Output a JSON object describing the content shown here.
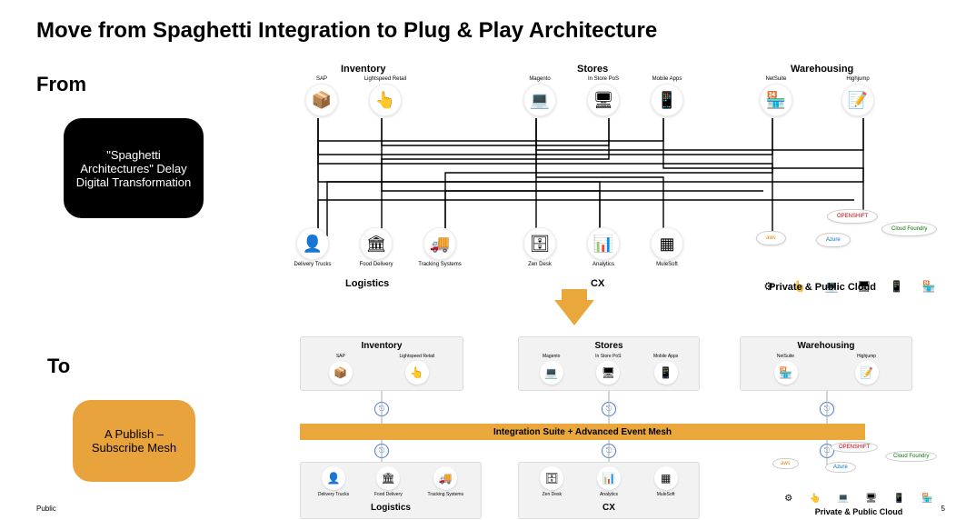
{
  "title": "Move from Spaghetti Integration to Plug & Play Architecture",
  "from_label": "From",
  "to_label": "To",
  "black_box": "\"Spaghetti Architectures\" Delay Digital Transformation",
  "orange_box": "A Publish – Subscribe Mesh",
  "footer": "Public",
  "page": "5",
  "down_arrow": "▼",
  "top": {
    "groups_upper": {
      "inventory": {
        "label": "Inventory",
        "systems": [
          {
            "name": "SAP",
            "glyph": "📦"
          },
          {
            "name": "Lightspeed Retail",
            "glyph": "👆"
          }
        ]
      },
      "stores": {
        "label": "Stores",
        "systems": [
          {
            "name": "Magento",
            "glyph": "💻"
          },
          {
            "name": "In Store PoS",
            "glyph": "🖥"
          },
          {
            "name": "Mobile Apps",
            "glyph": "📱"
          }
        ]
      },
      "warehousing": {
        "label": "Warehousing",
        "systems": [
          {
            "name": "NetSuite",
            "glyph": "🏪"
          },
          {
            "name": "Highjump",
            "glyph": "📝"
          }
        ]
      }
    },
    "groups_lower": {
      "logistics": {
        "label": "Logistics",
        "systems": [
          {
            "name": "Delivery Trucks",
            "glyph": "👤"
          },
          {
            "name": "Food Delivery",
            "glyph": "🏛"
          },
          {
            "name": "Tracking Systems",
            "glyph": "🚚"
          }
        ]
      },
      "cx": {
        "label": "CX",
        "systems": [
          {
            "name": "Zen Desk",
            "glyph": "🗄"
          },
          {
            "name": "Analytics",
            "glyph": "📊"
          },
          {
            "name": "MuleSoft",
            "glyph": "▦"
          }
        ]
      },
      "cloud": {
        "label": "Private & Public Cloud",
        "platforms": [
          "OPENSHIFT",
          "aws",
          "Azure",
          "Cloud Foundry"
        ],
        "mini_icons": [
          "⚙",
          "👆",
          "💻",
          "🖥",
          "📱",
          "🏪"
        ]
      }
    }
  },
  "bus_label": "Integration Suite + Advanced Event Mesh",
  "bottom": {
    "inventory": {
      "label": "Inventory",
      "systems": [
        {
          "name": "SAP",
          "glyph": "📦"
        },
        {
          "name": "Lightspeed Retail",
          "glyph": "👆"
        }
      ]
    },
    "stores": {
      "label": "Stores",
      "systems": [
        {
          "name": "Magento",
          "glyph": "💻"
        },
        {
          "name": "In Store PoS",
          "glyph": "🖥"
        },
        {
          "name": "Mobile Apps",
          "glyph": "📱"
        }
      ]
    },
    "warehousing": {
      "label": "Warehousing",
      "systems": [
        {
          "name": "NetSuite",
          "glyph": "🏪"
        },
        {
          "name": "Highjump",
          "glyph": "📝"
        }
      ]
    },
    "logistics": {
      "label": "Logistics",
      "systems": [
        {
          "name": "Delivery Trucks",
          "glyph": "👤"
        },
        {
          "name": "Food Delivery",
          "glyph": "🏛"
        },
        {
          "name": "Tracking Systems",
          "glyph": "🚚"
        }
      ]
    },
    "cx": {
      "label": "CX",
      "systems": [
        {
          "name": "Zen Desk",
          "glyph": "🗄"
        },
        {
          "name": "Analytics",
          "glyph": "📊"
        },
        {
          "name": "MuleSoft",
          "glyph": "▦"
        }
      ]
    },
    "cloud": {
      "label": "Private & Public Cloud",
      "platforms": [
        "OPENSHIFT",
        "aws",
        "Azure",
        "Cloud Foundry"
      ],
      "mini_icons": [
        "⚙",
        "👆",
        "💻",
        "🖥",
        "📱",
        "🏪"
      ]
    }
  },
  "bus_node_glyph": "⎋"
}
